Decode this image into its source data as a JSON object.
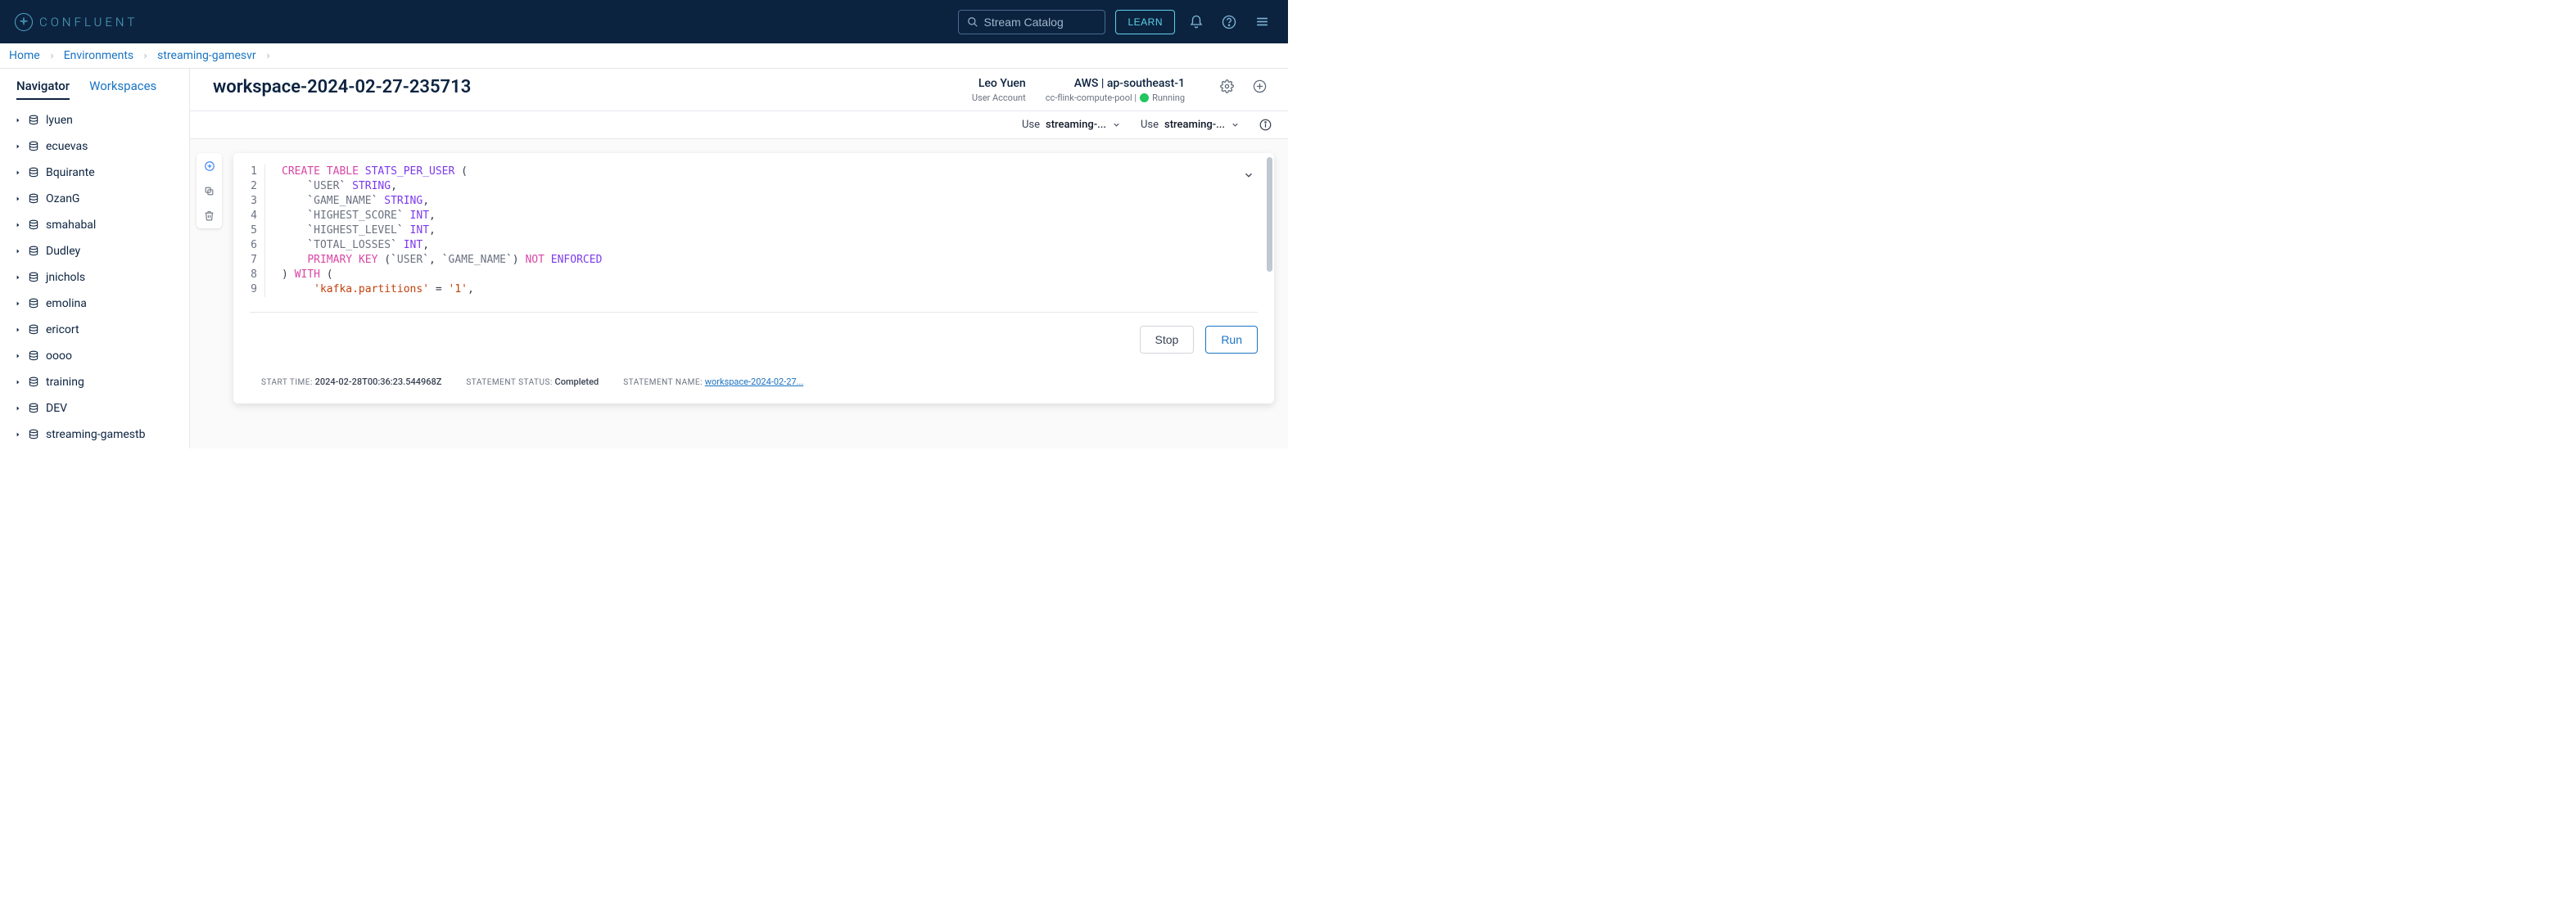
{
  "colors": {
    "header_bg": "#0c2340",
    "accent": "#1a73c2",
    "brand_teal": "#4da8c7"
  },
  "topbar": {
    "brand": "CONFLUENT",
    "search_placeholder": "Stream Catalog",
    "learn_label": "LEARN"
  },
  "breadcrumbs": [
    {
      "label": "Home"
    },
    {
      "label": "Environments"
    },
    {
      "label": "streaming-gamesvr"
    }
  ],
  "sidebar": {
    "tabs": {
      "navigator": "Navigator",
      "workspaces": "Workspaces"
    },
    "nodes": [
      {
        "label": "lyuen"
      },
      {
        "label": "ecuevas"
      },
      {
        "label": "Bquirante"
      },
      {
        "label": "OzanG"
      },
      {
        "label": "smahabal"
      },
      {
        "label": "Dudley"
      },
      {
        "label": "jnichols"
      },
      {
        "label": "emolina"
      },
      {
        "label": "ericort"
      },
      {
        "label": "oooo"
      },
      {
        "label": "training"
      },
      {
        "label": "DEV"
      },
      {
        "label": "streaming-gamestb"
      }
    ]
  },
  "workspace": {
    "title": "workspace-2024-02-27-235713",
    "user": {
      "name": "Leo Yuen",
      "sub": "User Account"
    },
    "env": {
      "name": "AWS | ap-southeast-1",
      "pool": "cc-flink-compute-pool |",
      "status": "Running"
    },
    "subbar": {
      "use1_label": "Use",
      "use1_value": "streaming-...",
      "use2_label": "Use",
      "use2_value": "streaming-..."
    },
    "editor": {
      "line_count": 9,
      "code_tokens": [
        [
          [
            "kw",
            "CREATE"
          ],
          [
            "",
            ""
          ],
          [
            "kw",
            "TABLE"
          ],
          [
            "",
            ""
          ],
          [
            "ty",
            "STATS_PER_USER"
          ],
          [
            "",
            ""
          ],
          [
            "",
            "("
          ]
        ],
        [
          [
            "",
            "    "
          ],
          [
            "",
            "`"
          ],
          [
            "id",
            "USER"
          ],
          [
            "",
            "`"
          ],
          [
            "",
            ""
          ],
          [
            "ty",
            "STRING"
          ],
          [
            "",
            ","
          ]
        ],
        [
          [
            "",
            "    "
          ],
          [
            "",
            "`"
          ],
          [
            "id",
            "GAME_NAME"
          ],
          [
            "",
            "`"
          ],
          [
            "",
            ""
          ],
          [
            "ty",
            "STRING"
          ],
          [
            "",
            ","
          ]
        ],
        [
          [
            "",
            "    "
          ],
          [
            "",
            "`"
          ],
          [
            "id",
            "HIGHEST_SCORE"
          ],
          [
            "",
            "`"
          ],
          [
            "",
            ""
          ],
          [
            "ty",
            "INT"
          ],
          [
            "",
            ","
          ]
        ],
        [
          [
            "",
            "    "
          ],
          [
            "",
            "`"
          ],
          [
            "id",
            "HIGHEST_LEVEL"
          ],
          [
            "",
            "`"
          ],
          [
            "",
            ""
          ],
          [
            "ty",
            "INT"
          ],
          [
            "",
            ","
          ]
        ],
        [
          [
            "",
            "    "
          ],
          [
            "",
            "`"
          ],
          [
            "id",
            "TOTAL_LOSSES"
          ],
          [
            "",
            "`"
          ],
          [
            "",
            ""
          ],
          [
            "ty",
            "INT"
          ],
          [
            "",
            ","
          ]
        ],
        [
          [
            "",
            "    "
          ],
          [
            "kw",
            "PRIMARY"
          ],
          [
            "",
            ""
          ],
          [
            "kw",
            "KEY"
          ],
          [
            "",
            ""
          ],
          [
            "",
            "("
          ],
          [
            "",
            "`"
          ],
          [
            "id",
            "USER"
          ],
          [
            "",
            "`"
          ],
          [
            "",
            ","
          ],
          [
            "",
            ""
          ],
          [
            "",
            "`"
          ],
          [
            "id",
            "GAME_NAME"
          ],
          [
            "",
            "`"
          ],
          [
            "",
            ")"
          ],
          [
            "",
            ""
          ],
          [
            "kw",
            "NOT"
          ],
          [
            "",
            ""
          ],
          [
            "ty",
            "ENFORCED"
          ]
        ],
        [
          [
            "",
            ")"
          ],
          [
            "",
            ""
          ],
          [
            "kw",
            "WITH"
          ],
          [
            "",
            ""
          ],
          [
            "",
            "("
          ]
        ],
        [
          [
            "",
            "     "
          ],
          [
            "str",
            "'kafka.partitions'"
          ],
          [
            "",
            ""
          ],
          [
            "",
            "="
          ],
          [
            "",
            ""
          ],
          [
            "str",
            "'1'"
          ],
          [
            "",
            ","
          ]
        ]
      ]
    },
    "buttons": {
      "stop": "Stop",
      "run": "Run"
    },
    "status": {
      "start_label": "START TIME:",
      "start_value": "2024-02-28T00:36:23.544968Z",
      "stmt_label": "STATEMENT STATUS:",
      "stmt_value": "Completed",
      "name_label": "STATEMENT NAME:",
      "name_value": "workspace-2024-02-27..."
    }
  }
}
